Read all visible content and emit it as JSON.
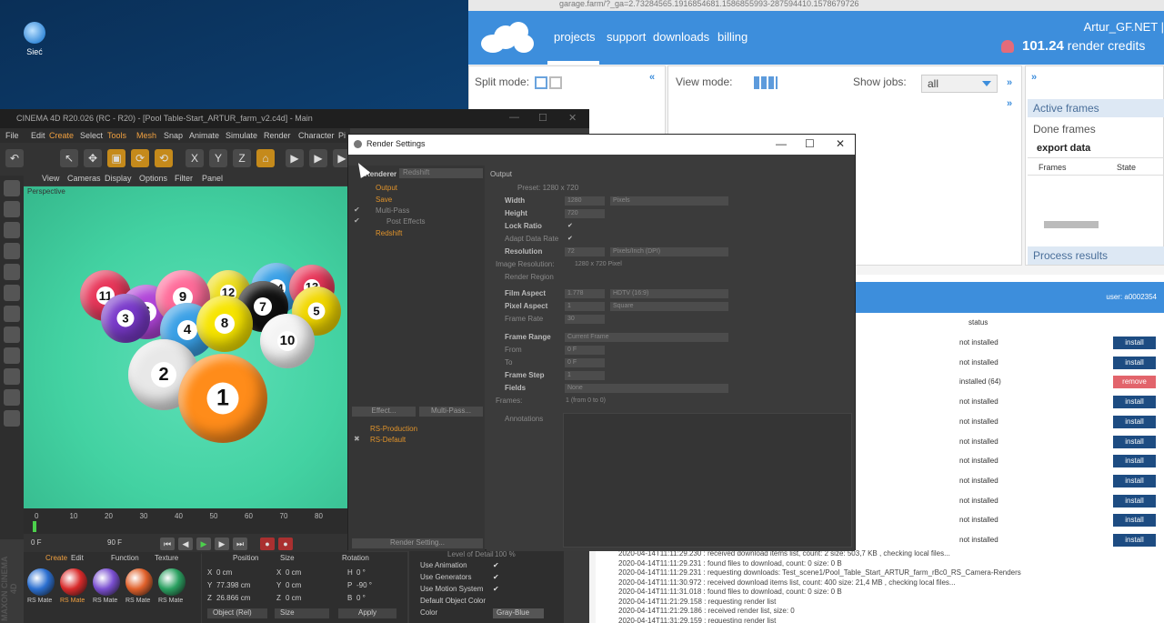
{
  "desktop": {
    "icon_label": "Sieć"
  },
  "browser": {
    "url": "garage.farm/?_ga=2.73284565.1916854681.1586855993-287594410.1578679726",
    "nav": [
      "projects",
      "support",
      "downloads",
      "billing"
    ],
    "user": "Artur_GF.NET |",
    "credits_value": "101.24",
    "credits_label": "render credits",
    "split_mode_label": "Split mode:",
    "view_mode_label": "View mode:",
    "show_jobs_label": "Show jobs:",
    "show_jobs_value": "all",
    "active_frames": "Active frames",
    "done_frames": "Done frames",
    "export_data": "export data",
    "col_frames": "Frames",
    "col_state": "State",
    "process_results": "Process results",
    "plugin_user": "user: a0002354",
    "status_header": "status",
    "plugins": [
      {
        "status": "not installed",
        "action": "install"
      },
      {
        "status": "not installed",
        "action": "install"
      },
      {
        "status": "installed (64)",
        "action": "remove"
      },
      {
        "status": "not installed",
        "action": "install"
      },
      {
        "status": "not installed",
        "action": "install"
      },
      {
        "status": "not installed",
        "action": "install"
      },
      {
        "status": "not installed",
        "action": "install"
      },
      {
        "status": "not installed",
        "action": "install"
      },
      {
        "status": "not installed",
        "action": "install"
      },
      {
        "status": "not installed",
        "action": "install"
      },
      {
        "status": "not installed",
        "action": "install"
      }
    ],
    "log": [
      "2020-04-14T11:11:29.230 : received download items list, count: 2 size: 503,7 KB , checking local files...",
      "2020-04-14T11:11:29.231 : found files to download, count: 0 size: 0 B",
      "2020-04-14T11:11:29.231 : requesting downloads: Test_scene1/Pool_Table_Start_ARTUR_farm_rBc0_RS_Camera-Renders",
      "2020-04-14T11:11:30.972 : received download items list, count: 400 size: 21,4 MB , checking local files...",
      "2020-04-14T11:11:31.018 : found files to download, count: 0 size: 0 B",
      "2020-04-14T11:21:29.158 : requesting render list",
      "2020-04-14T11:21:29.186 : received render list, size: 0",
      "2020-04-14T11:31:29.159 : requesting render list"
    ]
  },
  "c4d": {
    "title": "CINEMA 4D R20.026 (RC - R20) - [Pool Table-Start_ARTUR_farm_v2.c4d] - Main",
    "menu": [
      "File",
      "Edit",
      "Create",
      "Select",
      "Tools",
      "Mesh",
      "Snap",
      "Animate",
      "Simulate",
      "Render",
      "Character",
      "Pi"
    ],
    "viewport_menu": [
      "View",
      "Cameras",
      "Display",
      "Options",
      "Filter",
      "Panel"
    ],
    "viewport_label": "Perspective",
    "balls": [
      "11",
      "9",
      "6",
      "3",
      "4",
      "7",
      "8",
      "5",
      "10",
      "2",
      "1",
      "12",
      "14",
      "13"
    ],
    "timeline_ticks": [
      "0",
      "10",
      "20",
      "30",
      "40",
      "50",
      "60",
      "70",
      "80"
    ],
    "frame_start": "0 F",
    "frame_end": "90 F",
    "mat_tabs": [
      "Create",
      "Edit",
      "Function",
      "Texture"
    ],
    "materials": [
      "RS Mate",
      "RS Mate",
      "RS Mate",
      "RS Mate",
      "RS Mate"
    ],
    "coord_headers": [
      "Position",
      "Size",
      "Rotation"
    ],
    "coord_rows": [
      [
        "X",
        "0 cm",
        "X",
        "0 cm",
        "H",
        "0 °"
      ],
      [
        "Y",
        "77.398 cm",
        "Y",
        "0 cm",
        "P",
        "-90 °"
      ],
      [
        "Z",
        "26.866 cm",
        "Z",
        "0 cm",
        "B",
        "0 °"
      ]
    ],
    "coord_mode": "Object (Rel)",
    "coord_size": "Size",
    "apply": "Apply",
    "attr_rows": [
      "Use Animation",
      "Use Generators",
      "Use Motion System",
      "Default Object Color",
      "Color"
    ],
    "attr_color_value": "Gray-Blue",
    "level_detail": "Level of Detail",
    "level_value": "100 %",
    "maxon": "MAXON CINEMA 4D"
  },
  "rs": {
    "title": "Render Settings",
    "renderer_label": "Renderer",
    "renderer_value": "Redshift",
    "tree": [
      "Output",
      "Save",
      "Multi-Pass",
      "Post Effects",
      "Redshift"
    ],
    "effect_btn": "Effect...",
    "multipass_btn": "Multi-Pass...",
    "presets": [
      "RS-Production",
      "RS-Default"
    ],
    "render_setting_btn": "Render Setting...",
    "section": "Output",
    "preset": "Preset: 1280 x 720",
    "rows": [
      {
        "label": "Width",
        "value": "1280",
        "unit": "Pixels"
      },
      {
        "label": "Height",
        "value": "720",
        "unit": ""
      },
      {
        "label": "Lock Ratio",
        "value": "✔",
        "unit": ""
      },
      {
        "label": "Adapt Data Rate",
        "value": "✔",
        "unit": ""
      },
      {
        "label": "Resolution",
        "value": "72",
        "unit": "Pixels/Inch (DPI)"
      },
      {
        "label": "Image Resolution:",
        "value": "1280 x 720 Pixel",
        "unit": ""
      },
      {
        "label": "Render Region",
        "value": "",
        "unit": ""
      },
      {
        "label": "Film Aspect",
        "value": "1.778",
        "unit": "HDTV (16:9)"
      },
      {
        "label": "Pixel Aspect",
        "value": "1",
        "unit": "Square"
      },
      {
        "label": "Frame Rate",
        "value": "30",
        "unit": ""
      },
      {
        "label": "Frame Range",
        "value": "Current Frame",
        "unit": ""
      },
      {
        "label": "From",
        "value": "0 F",
        "unit": ""
      },
      {
        "label": "To",
        "value": "0 F",
        "unit": ""
      },
      {
        "label": "Frame Step",
        "value": "1",
        "unit": ""
      },
      {
        "label": "Fields",
        "value": "None",
        "unit": ""
      },
      {
        "label": "Frames:",
        "value": "1 (from 0 to 0)",
        "unit": ""
      }
    ],
    "annotations": "Annotations"
  }
}
